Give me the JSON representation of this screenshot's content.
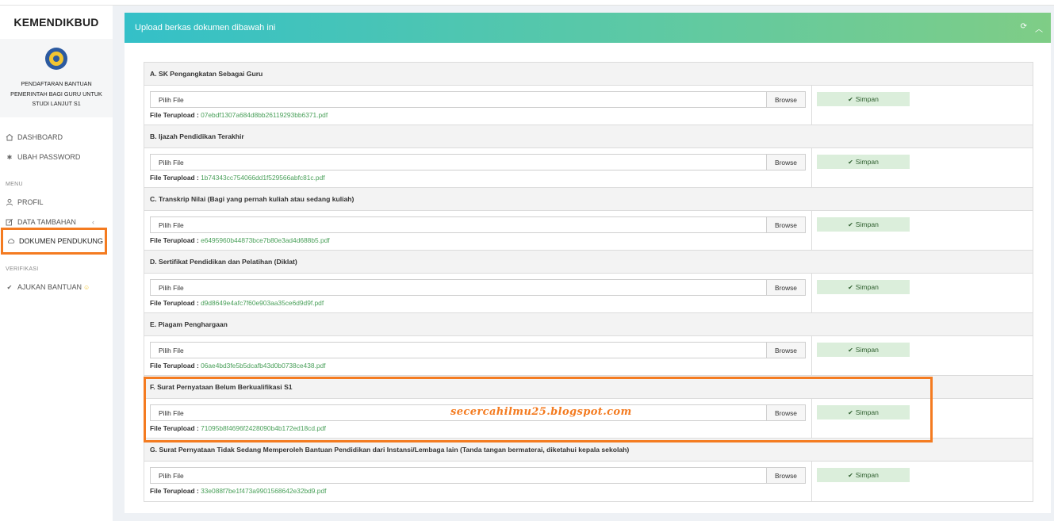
{
  "sidebar": {
    "brand": "KEMENDIKBUD",
    "description": "PENDAFTARAN BANTUAN PEMERINTAH BAGI GURU UNTUK STUDI LANJUT S1",
    "items": [
      {
        "label": "DASHBOARD",
        "icon": "home-icon"
      },
      {
        "label": "UBAH PASSWORD",
        "icon": "asterisk-icon"
      }
    ],
    "menu_title": "MENU",
    "menu_items": [
      {
        "label": "PROFIL",
        "icon": "user-icon"
      },
      {
        "label": "DATA TAMBAHAN",
        "icon": "edit-icon"
      },
      {
        "label": "DOKUMEN PENDUKUNG",
        "icon": "cloud-icon"
      }
    ],
    "verify_title": "VERIFIKASI",
    "verify_items": [
      {
        "label": "AJUKAN BANTUAN",
        "icon": "check-icon"
      }
    ]
  },
  "panel": {
    "title": "Upload berkas dokumen dibawah ini"
  },
  "common": {
    "file_placeholder": "Pilih File",
    "browse_label": "Browse",
    "uploaded_label": "File Terupload",
    "save_label": "Simpan"
  },
  "documents": [
    {
      "title": "A. SK Pengangkatan Sebagai Guru",
      "file": "07ebdf1307a684d8bb26119293bb6371.pdf"
    },
    {
      "title": "B. Ijazah Pendidikan Terakhir",
      "file": "1b74343cc754066dd1f529566abfc81c.pdf"
    },
    {
      "title": "C. Transkrip Nilai (Bagi yang pernah kuliah atau sedang kuliah)",
      "file": "e6495960b44873bce7b80e3ad4d688b5.pdf"
    },
    {
      "title": "D. Sertifikat Pendidikan dan Pelatihan (Diklat)",
      "file": "d9d8649e4afc7f60e903aa35ce6d9d9f.pdf"
    },
    {
      "title": "E. Piagam Penghargaan",
      "file": "06ae4bd3fe5b5dcafb43d0b0738ce438.pdf"
    },
    {
      "title": "F. Surat Pernyataan Belum Berkualifikasi S1",
      "file": "71095b8f4696f2428090b4b172ed18cd.pdf"
    },
    {
      "title": "G. Surat Pernyataan Tidak Sedang Memperoleh Bantuan Pendidikan dari Instansi/Lembaga lain (Tanda tangan bermaterai, diketahui kepala sekolah)",
      "file": "33e088f7be1f473a9901568642e32bd9.pdf"
    }
  ],
  "watermark": "secercahilmu25.blogspot.com",
  "colors": {
    "highlight": "#f47b20",
    "header_gradient_start": "#34c0c8",
    "header_gradient_end": "#7fcd86",
    "link": "#4aa05a",
    "save_bg": "#dbeedb"
  }
}
